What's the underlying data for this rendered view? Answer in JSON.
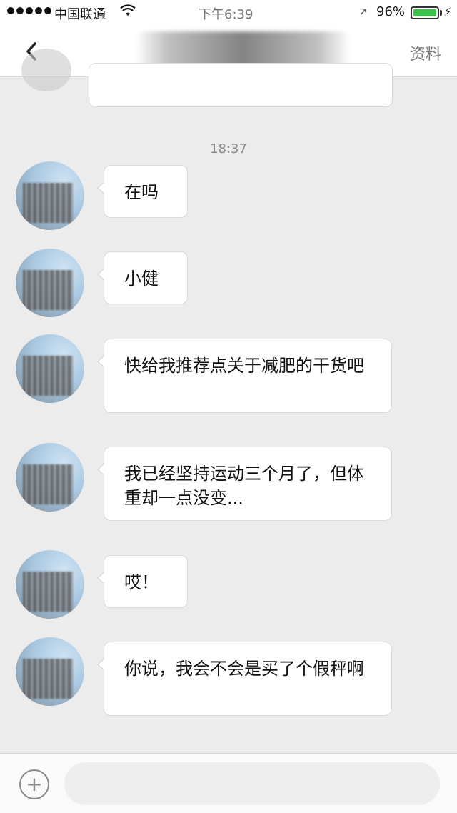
{
  "status_bar": {
    "carrier": "中国联通",
    "time": "下午6:39",
    "battery_percent": "96%",
    "signal_icon": "signal-dots-icon",
    "wifi_icon": "wifi-icon",
    "battery_level": 0.96
  },
  "nav": {
    "back_icon": "chevron-left-icon",
    "right_link": "资料"
  },
  "chat": {
    "timestamp": "18:37",
    "messages": [
      {
        "text": "在吗"
      },
      {
        "text": "小健"
      },
      {
        "text": "快给我推荐点关于减肥的干货吧"
      },
      {
        "text": "我已经坚持运动三个月了，但体重却一点没变..."
      },
      {
        "text": "哎！"
      },
      {
        "text": "你说，我会不会是买了个假秤啊"
      }
    ]
  },
  "input_bar": {
    "plus_icon": "plus-circle-icon",
    "placeholder": ""
  },
  "colors": {
    "background": "#ececec",
    "bubble": "#ffffff",
    "battery": "#3cc24a"
  }
}
